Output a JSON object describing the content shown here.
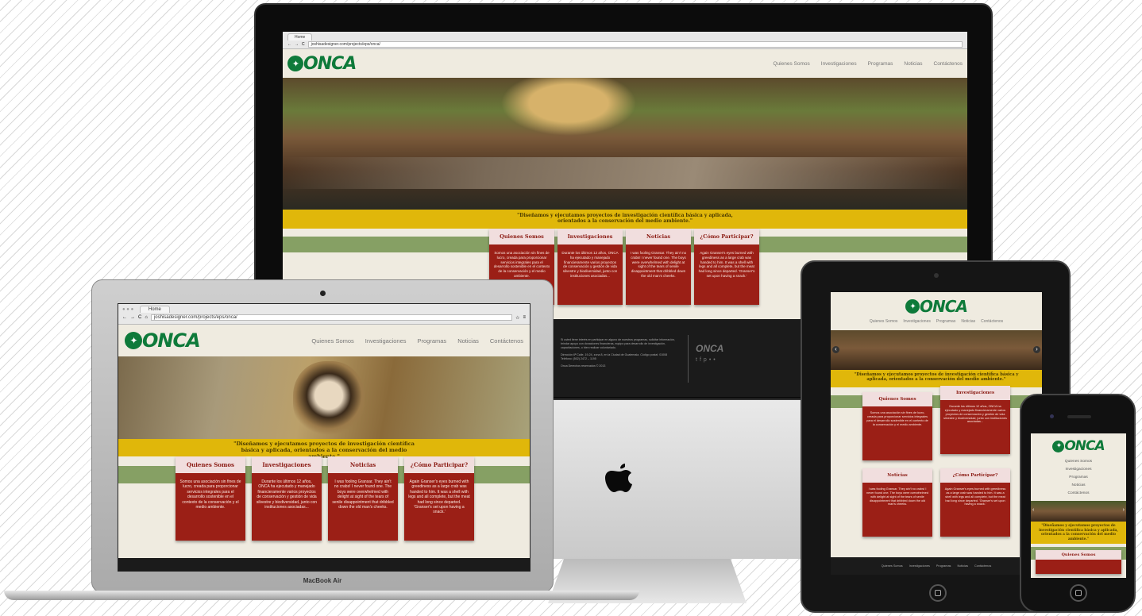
{
  "site": {
    "tab_title": "Home",
    "url": "joshisadesigner.com/projects/eps/onca/",
    "logo": "ONCA",
    "menu": [
      "Quienes Somos",
      "Investigaciones",
      "Programas",
      "Noticias",
      "Contáctenos"
    ],
    "tagline": "\"Diseñamos y ejecutamos proyectos de investigación científica básica y aplicada, orientados a la conservación del medio ambiente.\"",
    "cards": [
      {
        "title": "Quienes Somos",
        "body": "Somos una asociación sin fines de lucro, creada para proporcionar servicios integrales para el desarrollo sostenible en el contexto de la conservación y el medio ambiente."
      },
      {
        "title": "Investigaciones",
        "body": "Durante los últimos 12 años, ONCA ha ejecutado y manejado financieramente varios proyectos de conservación y gestión de vida silvestre y biodiversidad, junto con instituciones asociadas..."
      },
      {
        "title": "Noticias",
        "body": "I was fooling Gransar. They ain't no crabs! I never found one. The boys were overwhelmed with delight at sight of the tears of senile disappointment that dribbled down the old man's cheeks."
      },
      {
        "title": "¿Cómo Participar?",
        "body": "Again Granser's eyes burned with greediness as a large crab was handed to him. It was a shell with legs and all complete, but the meat had long since departed. 'Granser's set upon having a snack.'"
      }
    ],
    "footer_text": [
      "Si usted tiene interés en participar en alguno de nuestros programas, solicitar información, brindar apoyo con donaciones financieras, equipo para desarrollo de investigación, capacitaciones, o bien realizar voluntariado.",
      "Dirección 6ª Calle, 19-24, zona 8, en la Ciudad de Guatemala. Código postal: 01008",
      "Teléfono: (502) 2472 – 1195",
      "Onca Derechos reservados © 2013"
    ],
    "footer_logo": "ONCA",
    "social_icons": [
      "twitter-icon",
      "facebook-icon",
      "pinterest-icon",
      "flickr-icon"
    ],
    "mobile_slider_prev": "‹",
    "mobile_slider_next": "›"
  },
  "devices": {
    "macbook_label": "MacBook Air",
    "apple_logo": "",
    "imac_traffic": "",
    "home_button": ""
  },
  "colors": {
    "brand_green": "#0e7a3a",
    "band_yellow": "#e0b70a",
    "card_red": "#9b1f16",
    "stripe_green": "#86a064"
  }
}
